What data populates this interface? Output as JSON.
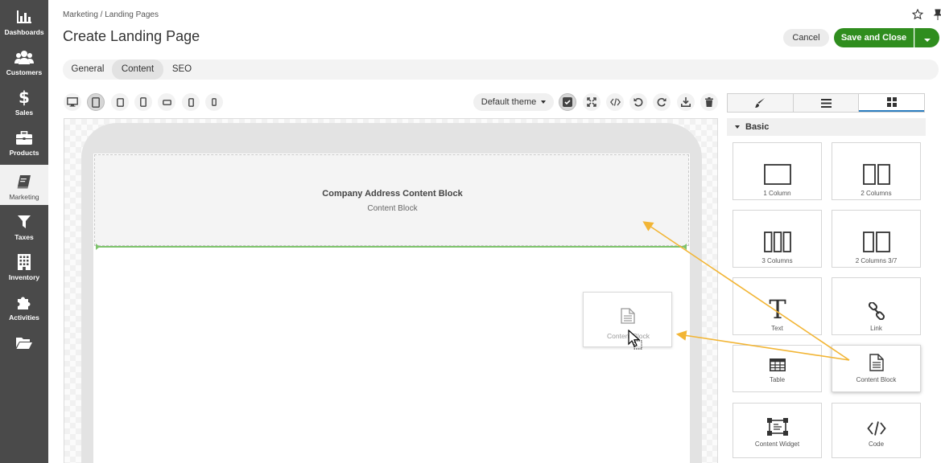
{
  "sidebar": {
    "items": [
      {
        "label": "Dashboards",
        "icon": "bar-chart-icon"
      },
      {
        "label": "Customers",
        "icon": "users-icon"
      },
      {
        "label": "Sales",
        "icon": "dollar-icon"
      },
      {
        "label": "Products",
        "icon": "briefcase-icon"
      },
      {
        "label": "Marketing",
        "icon": "book-icon"
      },
      {
        "label": "Taxes",
        "icon": "filter-icon"
      },
      {
        "label": "Inventory",
        "icon": "building-icon"
      },
      {
        "label": "Activities",
        "icon": "puzzle-icon"
      },
      {
        "label": "",
        "icon": "folder-open-icon"
      }
    ],
    "active": "Marketing"
  },
  "header": {
    "breadcrumb": "Marketing / Landing Pages",
    "title": "Create Landing Page",
    "cancel_label": "Cancel",
    "save_label": "Save and Close"
  },
  "tabs": [
    {
      "label": "General"
    },
    {
      "label": "Content",
      "active": true
    },
    {
      "label": "SEO"
    }
  ],
  "toolbar": {
    "theme_label": "Default theme"
  },
  "canvas": {
    "block_title": "Company Address Content Block",
    "block_subtitle": "Content Block",
    "drag_label": "Content Block"
  },
  "panel": {
    "section": "Basic",
    "blocks": [
      {
        "label": "1 Column",
        "icon": "one-column-icon"
      },
      {
        "label": "2 Columns",
        "icon": "two-columns-icon"
      },
      {
        "label": "3 Columns",
        "icon": "three-columns-icon"
      },
      {
        "label": "2 Columns 3/7",
        "icon": "two-columns-3-7-icon"
      },
      {
        "label": "Text",
        "icon": "text-icon"
      },
      {
        "label": "Link",
        "icon": "link-icon"
      },
      {
        "label": "Table",
        "icon": "table-icon"
      },
      {
        "label": "Content Block",
        "icon": "document-icon"
      },
      {
        "label": "Content Widget",
        "icon": "widget-icon"
      },
      {
        "label": "Code",
        "icon": "code-icon"
      }
    ]
  },
  "colors": {
    "sidebar": "#4a4a4a",
    "primary_green": "#2f8d1e",
    "drop_indicator": "#7dc36b",
    "annotation_arrow": "#f2b535",
    "active_tab_underline": "#2d7fc1"
  }
}
